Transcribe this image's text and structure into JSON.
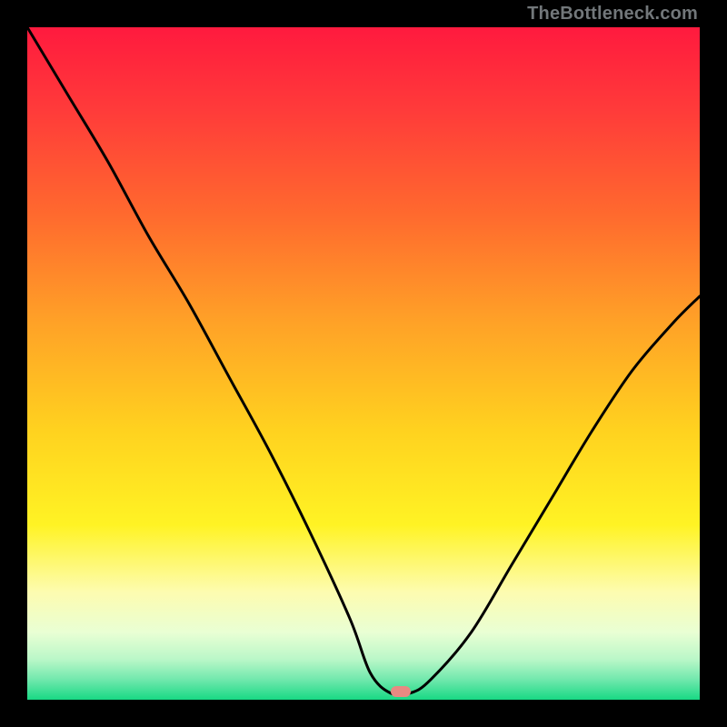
{
  "watermark": "TheBottleneck.com",
  "colors": {
    "black": "#000000",
    "marker": "#e78a82",
    "curve": "#000000",
    "gradient_stops": [
      {
        "offset": 0.0,
        "color": "#ff1a3e"
      },
      {
        "offset": 0.12,
        "color": "#ff3a3a"
      },
      {
        "offset": 0.28,
        "color": "#ff6a2e"
      },
      {
        "offset": 0.44,
        "color": "#ffa227"
      },
      {
        "offset": 0.6,
        "color": "#ffd21f"
      },
      {
        "offset": 0.74,
        "color": "#fff324"
      },
      {
        "offset": 0.84,
        "color": "#fdfcb0"
      },
      {
        "offset": 0.9,
        "color": "#e9ffd4"
      },
      {
        "offset": 0.94,
        "color": "#baf7c8"
      },
      {
        "offset": 0.97,
        "color": "#71e8ad"
      },
      {
        "offset": 1.0,
        "color": "#18d984"
      }
    ]
  },
  "marker": {
    "x_pct": 55.5,
    "y_pct": 98.8
  },
  "chart_data": {
    "type": "line",
    "title": "",
    "xlabel": "",
    "ylabel": "",
    "xlim": [
      0,
      100
    ],
    "ylim": [
      0,
      100
    ],
    "note": "V-shaped bottleneck curve; y≈0 near x≈55, rising toward 100 at the left edge and ~60 at the right edge. Background is a vertical severity gradient (red top → green bottom).",
    "series": [
      {
        "name": "bottleneck-curve",
        "x": [
          0,
          6,
          12,
          18,
          24,
          30,
          36,
          42,
          48,
          51,
          54,
          57,
          60,
          66,
          72,
          78,
          84,
          90,
          96,
          100
        ],
        "y": [
          100,
          90,
          80,
          69,
          59,
          48,
          37,
          25,
          12,
          4,
          1,
          1,
          3,
          10,
          20,
          30,
          40,
          49,
          56,
          60
        ]
      }
    ],
    "marker_point": {
      "x": 55.5,
      "y": 1
    }
  }
}
